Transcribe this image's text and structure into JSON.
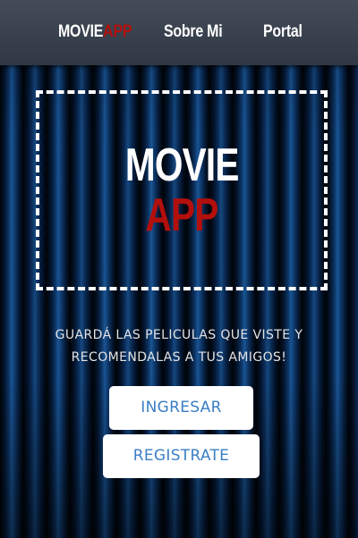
{
  "navbar": {
    "brand_main": "MOVIE",
    "brand_accent": "APP",
    "about_label": "Sobre Mi",
    "portal_label": "Portal"
  },
  "hero": {
    "logo_line1": "MOVIE",
    "logo_line2": "APP",
    "tagline_line1": "GUARDÁ LAS PELICULAS QUE VISTE Y",
    "tagline_line2": "RECOMENDALAS A TUS AMIGOS!"
  },
  "actions": {
    "login_label": "INGRESAR",
    "register_label": "REGISTRATE"
  },
  "colors": {
    "accent_red": "#b30f0c",
    "button_text_blue": "#3a7fc4",
    "navbar_bg": "#3b444f",
    "curtain_blue": "#0d3668"
  }
}
